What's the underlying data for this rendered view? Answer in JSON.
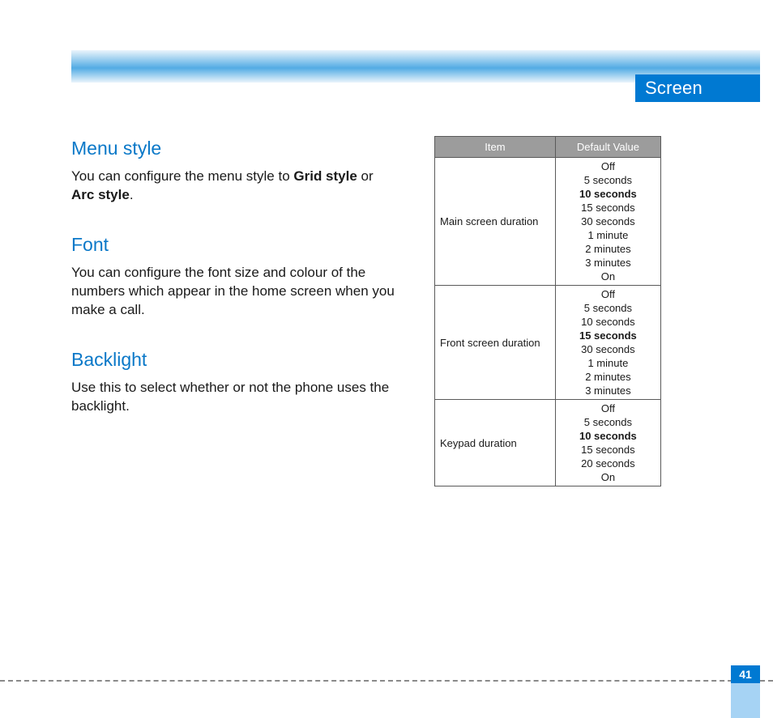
{
  "header": {
    "tab": "Screen"
  },
  "left": {
    "sections": [
      {
        "heading": "Menu style",
        "body_pre": "You can configure the menu style to ",
        "bold1": "Grid style",
        "mid": " or ",
        "bold2": "Arc style",
        "post": "."
      },
      {
        "heading": "Font",
        "body": "You can configure the font size and colour of the numbers which appear in the home screen when you make a call."
      },
      {
        "heading": "Backlight",
        "body": "Use this to select whether or not the phone uses the backlight."
      }
    ]
  },
  "table": {
    "headers": {
      "item": "Item",
      "default": "Default Value"
    },
    "rows": [
      {
        "name": "Main screen duration",
        "options": [
          {
            "label": "Off",
            "bold": false
          },
          {
            "label": "5 seconds",
            "bold": false
          },
          {
            "label": "10 seconds",
            "bold": true
          },
          {
            "label": "15 seconds",
            "bold": false
          },
          {
            "label": "30 seconds",
            "bold": false
          },
          {
            "label": "1 minute",
            "bold": false
          },
          {
            "label": "2 minutes",
            "bold": false
          },
          {
            "label": "3 minutes",
            "bold": false
          },
          {
            "label": "On",
            "bold": false
          }
        ]
      },
      {
        "name": "Front screen duration",
        "options": [
          {
            "label": "Off",
            "bold": false
          },
          {
            "label": "5 seconds",
            "bold": false
          },
          {
            "label": "10 seconds",
            "bold": false
          },
          {
            "label": "15 seconds",
            "bold": true
          },
          {
            "label": "30 seconds",
            "bold": false
          },
          {
            "label": "1 minute",
            "bold": false
          },
          {
            "label": "2 minutes",
            "bold": false
          },
          {
            "label": "3 minutes",
            "bold": false
          }
        ]
      },
      {
        "name": "Keypad duration",
        "options": [
          {
            "label": "Off",
            "bold": false
          },
          {
            "label": "5 seconds",
            "bold": false
          },
          {
            "label": "10 seconds",
            "bold": true
          },
          {
            "label": "15 seconds",
            "bold": false
          },
          {
            "label": "20 seconds",
            "bold": false
          },
          {
            "label": "On",
            "bold": false
          }
        ]
      }
    ]
  },
  "page_number": "41"
}
